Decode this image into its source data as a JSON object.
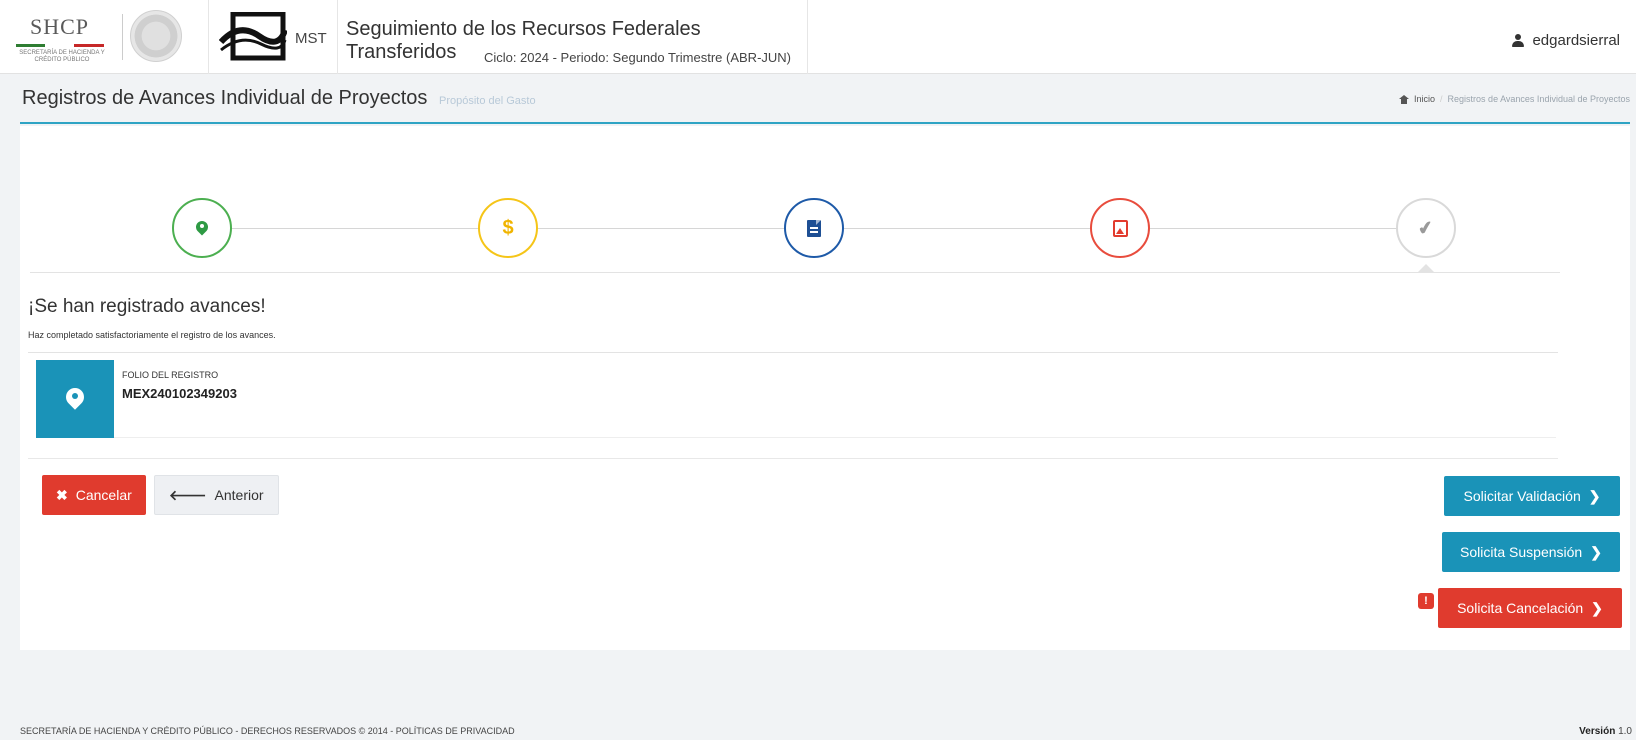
{
  "header": {
    "shcp_logo_text": "SHCP",
    "shcp_logo_sub": "Secretaría de Hacienda y Crédito Público",
    "mst_label": "MST",
    "app_title": "Seguimiento de los Recursos Federales Transferidos",
    "cycle_info": "Ciclo: 2024 - Periodo: Segundo Trimestre (ABR-JUN)",
    "username": "edgardsierral"
  },
  "page": {
    "title": "Registros de Avances Individual de Proyectos",
    "subtitle": "Propósito del Gasto",
    "breadcrumb": {
      "home": "Inicio",
      "current": "Registros de Avances Individual de Proyectos"
    }
  },
  "wizard": {
    "steps": [
      {
        "icon": "map-marker-icon",
        "color": "#4caf50"
      },
      {
        "icon": "dollar-icon",
        "color": "#f5c518",
        "glyph": "$"
      },
      {
        "icon": "document-icon",
        "color": "#1e5aa8"
      },
      {
        "icon": "image-icon",
        "color": "#e84c3d"
      },
      {
        "icon": "check-icon",
        "color": "#d9d9d9",
        "glyph": "✔"
      }
    ]
  },
  "message": {
    "title": "¡Se han registrado avances!",
    "text": "Haz completado satisfactoriamente el registro de los avances."
  },
  "folio": {
    "label": "FOLIO DEL REGISTRO",
    "value": "MEX240102349203"
  },
  "buttons": {
    "cancel": "Cancelar",
    "previous": "Anterior",
    "request_validation": "Solicitar Validación",
    "request_suspension": "Solicita Suspensión",
    "request_cancellation": "Solicita Cancelación"
  },
  "footer": {
    "left": "SECRETARÍA DE HACIENDA Y CRÉDITO PÚBLICO - DERECHOS RESERVADOS © 2014 - POLÍTICAS DE PRIVACIDAD",
    "version_label": "Versión",
    "version_value": "1.0"
  },
  "colors": {
    "accent": "#1a93b8",
    "danger": "#e03b2e"
  }
}
